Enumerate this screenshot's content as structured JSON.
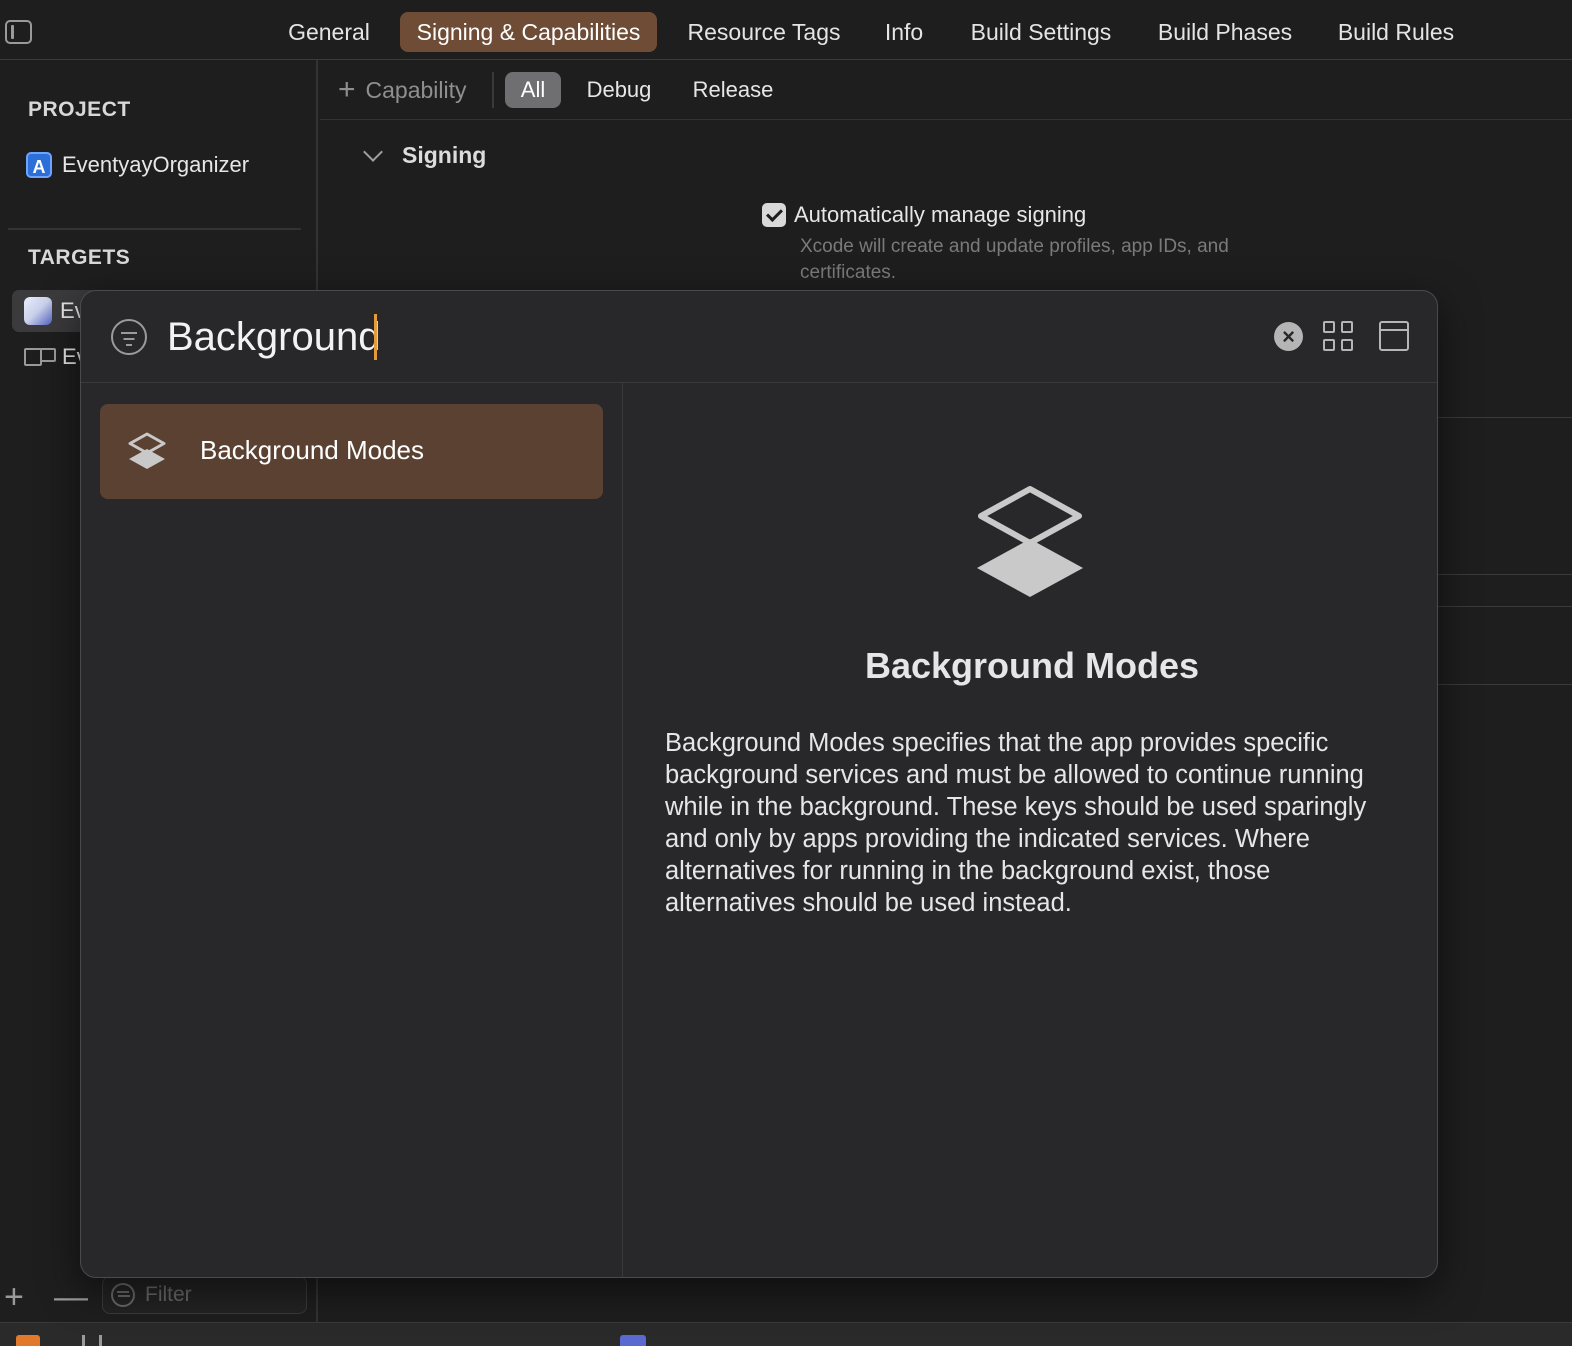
{
  "tabs": [
    {
      "label": "General"
    },
    {
      "label": "Signing & Capabilities",
      "active": true
    },
    {
      "label": "Resource Tags"
    },
    {
      "label": "Info"
    },
    {
      "label": "Build Settings"
    },
    {
      "label": "Build Phases"
    },
    {
      "label": "Build Rules"
    }
  ],
  "sidebar": {
    "project_heading": "PROJECT",
    "project_name": "EventyayOrganizer",
    "targets_heading": "TARGETS",
    "targets": [
      {
        "label": "Ev",
        "selected": true
      },
      {
        "label": "Ev"
      }
    ],
    "filter_placeholder": "Filter"
  },
  "toolbar": {
    "capability_label": "Capability",
    "segments": [
      {
        "label": "All",
        "active": true
      },
      {
        "label": "Debug"
      },
      {
        "label": "Release"
      }
    ]
  },
  "signing": {
    "section_title": "Signing",
    "auto_manage_label": "Automatically manage signing",
    "auto_manage_checked": true,
    "auto_manage_desc": "Xcode will create and update profiles, app IDs, and certificates."
  },
  "library": {
    "search_value": "Background",
    "results": [
      {
        "label": "Background Modes",
        "icon": "layers-icon",
        "selected": true
      }
    ],
    "detail": {
      "title": "Background Modes",
      "icon": "layers-icon",
      "description": "Background Modes specifies that the app provides specific background services and must be allowed to continue running while in the background. These keys should be used sparingly and only by apps providing the indicated services. Where alternatives for running in the background exist, those alternatives should be used instead."
    }
  },
  "colors": {
    "active_tab": "#6e4c36",
    "selected_result": "#5a4132",
    "caret": "#e39a3a",
    "background": "#1e1e1e",
    "panel": "#28282a"
  }
}
